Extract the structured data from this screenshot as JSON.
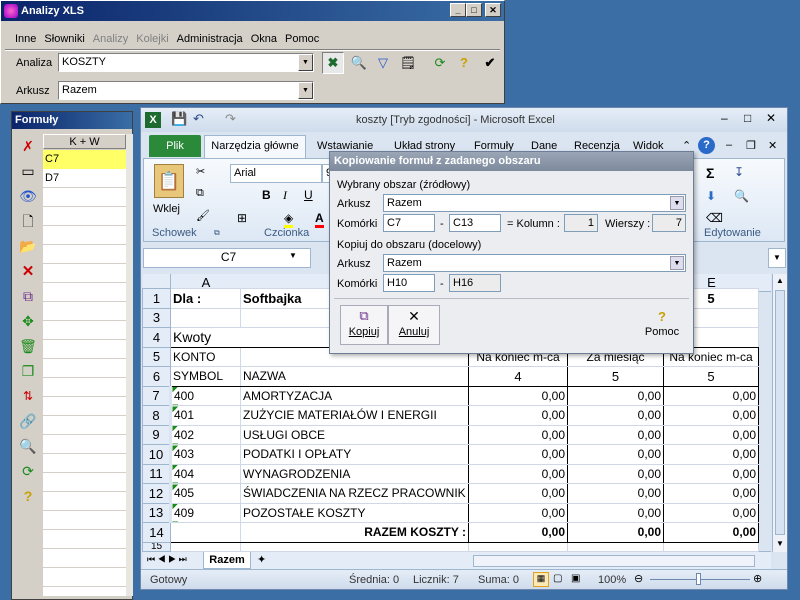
{
  "analizy": {
    "title": "Analizy XLS",
    "menu": [
      "Inne",
      "Słowniki",
      "Analizy",
      "Kolejki",
      "Administracja",
      "Okna",
      "Pomoc"
    ],
    "analiza_label": "Analiza",
    "analiza_value": "KOSZTY",
    "arkusz_label": "Arkusz",
    "arkusz_value": "Razem"
  },
  "formuly": {
    "title": "Formuły",
    "header": "K + W",
    "rows": [
      "C7",
      "D7"
    ]
  },
  "excel": {
    "title": "koszty  [Tryb zgodności]  -  Microsoft Excel",
    "tabs": [
      "Plik",
      "Narzędzia główne",
      "Wstawianie",
      "Układ strony",
      "Formuły",
      "Dane",
      "Recenzja",
      "Widok"
    ],
    "font_name": "Arial",
    "font_size": "9",
    "groups": {
      "schowek": "Schowek",
      "czcionka": "Czcionka",
      "edytowanie": "Edytowanie",
      "wklej": "Wklej"
    },
    "name_box": "C7",
    "columns": [
      "A",
      "E"
    ],
    "sheet_tab": "Razem",
    "status": {
      "ready": "Gotowy",
      "avg": "Średnia: 0",
      "count": "Licznik: 7",
      "sum": "Suma: 0",
      "zoom": "100%"
    }
  },
  "sheet": {
    "r1": {
      "a": "Dla :",
      "b": "Softbajka",
      "e": "5"
    },
    "r4": "Kwoty",
    "r5": {
      "a": "KONTO",
      "c": "Na koniec m-ca",
      "d": "Za miesiąc",
      "e": "Na koniec m-ca"
    },
    "r6": {
      "a": "SYMBOL",
      "b": "NAZWA",
      "c": "4",
      "d": "5",
      "e": "5"
    },
    "rows": [
      {
        "n": "7",
        "symbol": "400",
        "name": "AMORTYZACJA",
        "c": "0,00",
        "d": "0,00",
        "e": "0,00"
      },
      {
        "n": "8",
        "symbol": "401",
        "name": "ZUŻYCIE MATERIAŁÓW I ENERGII",
        "c": "0,00",
        "d": "0,00",
        "e": "0,00"
      },
      {
        "n": "9",
        "symbol": "402",
        "name": "USŁUGI OBCE",
        "c": "0,00",
        "d": "0,00",
        "e": "0,00"
      },
      {
        "n": "10",
        "symbol": "403",
        "name": "PODATKI I OPŁATY",
        "c": "0,00",
        "d": "0,00",
        "e": "0,00"
      },
      {
        "n": "11",
        "symbol": "404",
        "name": "WYNAGRODZENIA",
        "c": "0,00",
        "d": "0,00",
        "e": "0,00"
      },
      {
        "n": "12",
        "symbol": "405",
        "name": "ŚWIADCZENIA NA RZECZ PRACOWNIK",
        "c": "0,00",
        "d": "0,00",
        "e": "0,00"
      },
      {
        "n": "13",
        "symbol": "409",
        "name": "POZOSTAŁE KOSZTY",
        "c": "0,00",
        "d": "0,00",
        "e": "0,00"
      }
    ],
    "r14": {
      "label": "RAZEM KOSZTY :",
      "c": "0,00",
      "d": "0,00",
      "e": "0,00"
    },
    "row_nums": [
      "1",
      "3",
      "4",
      "5",
      "6",
      "14",
      "15"
    ]
  },
  "dialog": {
    "title": "Kopiowanie formuł z zadanego obszaru",
    "src_section": "Wybrany obszar (źródłowy)",
    "arkusz_label": "Arkusz",
    "src_arkusz": "Razem",
    "komorki_label": "Komórki",
    "src_from": "C7",
    "src_to": "C13",
    "kolumn_label": "= Kolumn :",
    "kolumn": "1",
    "wierszy_label": "Wierszy :",
    "wierszy": "7",
    "dst_section": "Kopiuj do obszaru (docelowy)",
    "dst_arkusz": "Razem",
    "dst_from": "H10",
    "dst_to": "H16",
    "dash": "-",
    "btn_copy": "Kopiuj",
    "btn_cancel": "Anuluj",
    "btn_help": "Pomoc"
  }
}
